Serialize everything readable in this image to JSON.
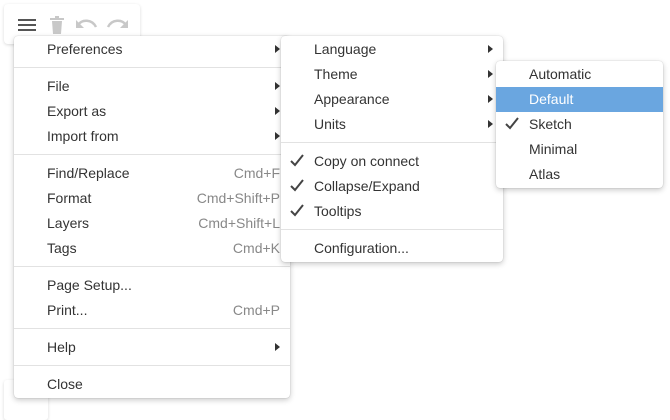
{
  "toolbar": {
    "icons": [
      "menu-icon",
      "trash-icon",
      "undo-icon",
      "redo-icon"
    ]
  },
  "main_menu": {
    "groups": [
      [
        {
          "label": "Preferences",
          "submenu": true
        }
      ],
      [
        {
          "label": "File",
          "submenu": true
        },
        {
          "label": "Export as",
          "submenu": true
        },
        {
          "label": "Import from",
          "submenu": true
        }
      ],
      [
        {
          "label": "Find/Replace",
          "shortcut": "Cmd+F"
        },
        {
          "label": "Format",
          "shortcut": "Cmd+Shift+P"
        },
        {
          "label": "Layers",
          "shortcut": "Cmd+Shift+L"
        },
        {
          "label": "Tags",
          "shortcut": "Cmd+K"
        }
      ],
      [
        {
          "label": "Page Setup..."
        },
        {
          "label": "Print...",
          "shortcut": "Cmd+P"
        }
      ],
      [
        {
          "label": "Help",
          "submenu": true
        }
      ],
      [
        {
          "label": "Close"
        }
      ]
    ]
  },
  "preferences_menu": {
    "groups": [
      [
        {
          "label": "Language",
          "submenu": true
        },
        {
          "label": "Theme",
          "submenu": true
        },
        {
          "label": "Appearance",
          "submenu": true
        },
        {
          "label": "Units",
          "submenu": true
        }
      ],
      [
        {
          "label": "Copy on connect",
          "checked": true
        },
        {
          "label": "Collapse/Expand",
          "checked": true
        },
        {
          "label": "Tooltips",
          "checked": true
        }
      ],
      [
        {
          "label": "Configuration..."
        }
      ]
    ]
  },
  "theme_menu": {
    "groups": [
      [
        {
          "label": "Automatic"
        },
        {
          "label": "Default",
          "highlighted": true
        },
        {
          "label": "Sketch",
          "checked": true
        },
        {
          "label": "Minimal"
        },
        {
          "label": "Atlas"
        }
      ]
    ]
  },
  "colors": {
    "highlight": "#6aa6e0",
    "text": "#333333",
    "shortcut": "#888888",
    "separator": "#e2e2e2"
  }
}
